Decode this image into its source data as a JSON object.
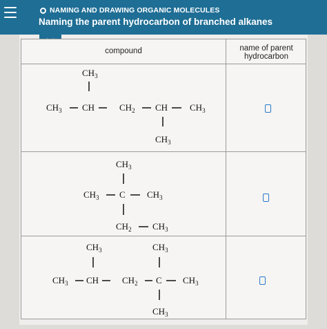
{
  "header": {
    "topic": "NAMING AND DRAWING ORGANIC MOLECULES",
    "title": "Naming the parent hydrocarbon of branched alkanes"
  },
  "table": {
    "col_compound": "compound",
    "col_name": "name of parent hydrocarbon"
  },
  "labels": {
    "ch3": "CH",
    "ch": "CH",
    "ch2": "CH",
    "c": "C",
    "sub3": "3",
    "sub2": "2"
  },
  "colors": {
    "header_bg": "#1e6e95",
    "answer_box": "#2a77c9"
  }
}
